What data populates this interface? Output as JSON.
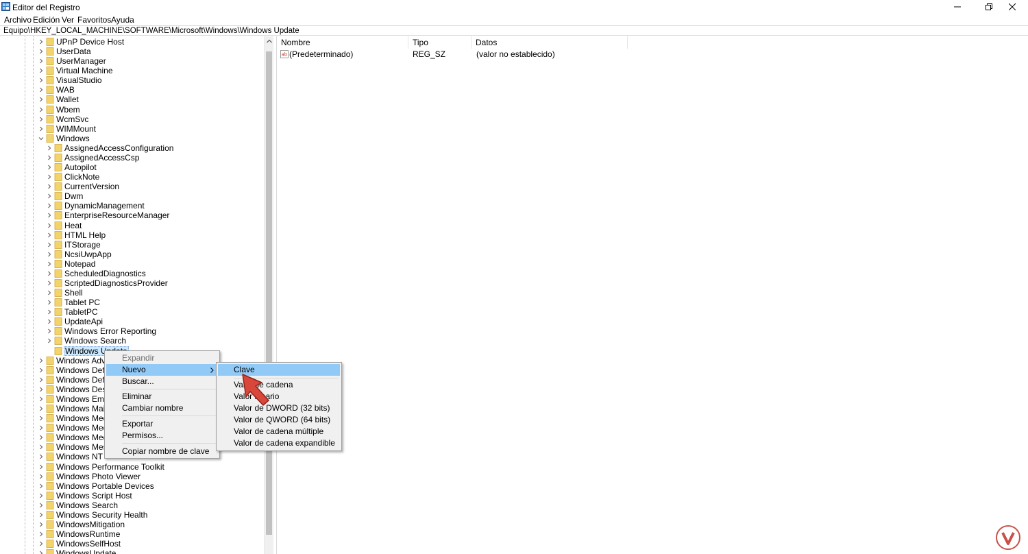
{
  "window": {
    "title": "Editor del Registro",
    "icons": {
      "app": "registry-editor-icon",
      "minimize": "minimize-icon",
      "restore": "restore-icon",
      "close": "close-icon"
    }
  },
  "menu": {
    "archivo": "Archivo",
    "edicion": "Edición",
    "ver": "Ver",
    "favoritos": "Favoritos",
    "ayuda": "Ayuda"
  },
  "address": "Equipo\\HKEY_LOCAL_MACHINE\\SOFTWARE\\Microsoft\\Windows\\Windows Update",
  "tree": {
    "upper": [
      "UPnP Device Host",
      "UserData",
      "UserManager",
      "Virtual Machine",
      "VisualStudio",
      "WAB",
      "Wallet",
      "Wbem",
      "WcmSvc",
      "WIMMount"
    ],
    "windows": "Windows",
    "children": [
      "AssignedAccessConfiguration",
      "AssignedAccessCsp",
      "Autopilot",
      "ClickNote",
      "CurrentVersion",
      "Dwm",
      "DynamicManagement",
      "EnterpriseResourceManager",
      "Heat",
      "HTML Help",
      "ITStorage",
      "NcsiUwpApp",
      "Notepad",
      "ScheduledDiagnostics",
      "ScriptedDiagnosticsProvider",
      "Shell",
      "Tablet PC",
      "TabletPC",
      "UpdateApi",
      "Windows Error Reporting",
      "Windows Search"
    ],
    "selected": "Windows Update",
    "lower": [
      "Windows Advanced Threat Protection",
      "Windows Defender",
      "Windows Defender Security Center",
      "Windows Desktop Search",
      "Windows Embedded",
      "Windows Mail",
      "Windows Media Device Manager",
      "Windows Media Foundation",
      "Windows Media Player NSS",
      "Windows Messaging Subsystem",
      "Windows NT",
      "Windows Performance Toolkit",
      "Windows Photo Viewer",
      "Windows Portable Devices",
      "Windows Script Host",
      "Windows Search",
      "Windows Security Health",
      "WindowsMitigation",
      "WindowsRuntime",
      "WindowsSelfHost",
      "WindowsUpdate"
    ]
  },
  "list": {
    "headers": {
      "nombre": "Nombre",
      "tipo": "Tipo",
      "datos": "Datos"
    },
    "rows": [
      {
        "nombre": "(Predeterminado)",
        "tipo": "REG_SZ",
        "datos": "(valor no establecido)",
        "icon": "string-value-icon"
      }
    ]
  },
  "context_menu": {
    "expandir": "Expandir",
    "nuevo": "Nuevo",
    "buscar": "Buscar...",
    "eliminar": "Eliminar",
    "cambiar_nombre": "Cambiar nombre",
    "exportar": "Exportar",
    "permisos": "Permisos...",
    "copiar": "Copiar nombre de clave"
  },
  "submenu": {
    "clave": "Clave",
    "valor_cadena": "Valor de cadena",
    "valor_binario": "Valor binario",
    "valor_dword": "Valor de DWORD (32 bits)",
    "valor_qword": "Valor de QWORD (64 bits)",
    "valor_multi": "Valor de cadena múltiple",
    "valor_expandible": "Valor de cadena expandible"
  },
  "colors": {
    "highlight": "#91c9f7",
    "selection": "#cce8ff",
    "folder": "#f3d36b",
    "pointer": "#d9473b"
  }
}
